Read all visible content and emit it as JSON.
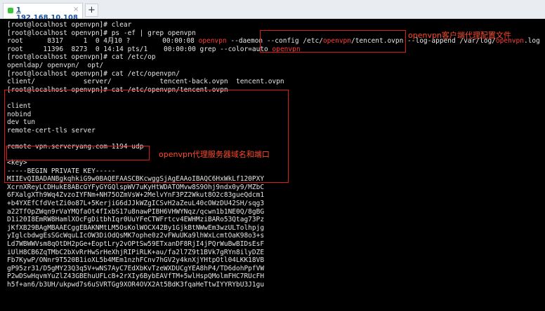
{
  "tab": {
    "title": "1 192.168.10.108",
    "close": "×",
    "new_tab": "+"
  },
  "terminal": {
    "lines": [
      "[root@localhost openvpn]# clear",
      "[root@localhost openvpn]# ps -ef | grep openvpn",
      "root      8317     1  0 4月10 ?        00:00:08 openvpn --daemon --config /etc/openvpn/tencent.ovpn --log-append /var/log/openvpn.log",
      "root     11396  8273  0 14:14 pts/1    00:00:00 grep --color=auto openvpn",
      "[root@localhost openvpn]# cat /etc/op",
      "openldap/ openvpn/  opt/",
      "[root@localhost openvpn]# cat /etc/openvpn/",
      "client/            server/            tencent-back.ovpn  tencent.ovpn",
      "[root@localhost openvpn]# cat /etc/openvpn/tencent.ovpn",
      "",
      "client",
      "nobind",
      "dev tun",
      "remote-cert-tls server",
      "",
      "remote vpn.serveryang.com 1194 udp",
      "",
      "<key>",
      "-----BEGIN PRIVATE KEY-----",
      "MIIEvQIBADANBgkqhkiG9w0BAQEFAASCBKcwggSjAgEAAoIBAQC6HxWkLf120PXY",
      "XcrnXReyLCDHukE8ABcGYFyGYGQlspWV7uKyHtWDATOMvw8S9Ohj9ndx0y9/MZbC",
      "6FXalgXTh9Wq4ZvzoIYFNm+NH75OZmVsW+2MelvYnF3PZ2Wkut8O2c83gueQdcm1",
      "+b4YXEfCfdVetZi0o87L+5KerjiG6dJJkWZgICSvH2aZeuL40cOWzDU42SH/sqg3",
      "a22TfOpZWqn9rVaYMQfaOt4fIxbS17u8nawPIBH6VHWYNqz/qcwn1b1NE0Q/8gBG",
      "D1i20I8EmRW8HamlXOcFgDitbhIqr0UuYFeCTWFrtcv4EWHMziBARo53Qtag73Pz",
      "jKfXB29BAgMBAAECggEBAKNMtLM5OsKolWOCX42By1GjkBtNWwEm3wzULTolhpjg",
      "yIglcbdwgEsSGcWquLIcOW3DiOdQsMK7ophe0z2vFWuUKa9lhWxLcmtOaK98o3+s",
      "Ld7WBWWVsm8qOtDH2pGe+EoptLry2vOPtSw59ETxanDF8RjI4jPQrWuBwBIDsEsF",
      "iUlH8CB6ZqTMbC2bXvRrHwSrHeXhjRIPiRLK+au/fa2l7Z9t1BVk7gRYn8ilyDZE",
      "Fb7KywP/ONnr9T520B1ioXL5b4MEm1nzhFCnv7hGV2y4knXjYHtpOtl04LKK18VB",
      "gP95zr31/D5gMY23Q3q5V+wNS7AyC7EdXbKvTzeWXDUCgYEA8hP4/TD6dohPpfVW",
      "P2wDSwHqvmYuZlZ43GBEhuUFLcB+2rXIy6BybEAVfTM+5wlHspQMolmFHC7RUcFH",
      "h5f+an6/b3UH/ukpwd7s6uSVRTGg9XOR4OVX2At5BdK3fqaHeTtwIYYRYbU3J1gu"
    ]
  },
  "annotations": {
    "config": "openvpn客户端代理配置文件",
    "server": "openvpn代理服务器域名和端口"
  },
  "colors": {
    "highlight": "#ff3b3b",
    "annotation": "#ff4a2a",
    "box": "#e01818"
  }
}
